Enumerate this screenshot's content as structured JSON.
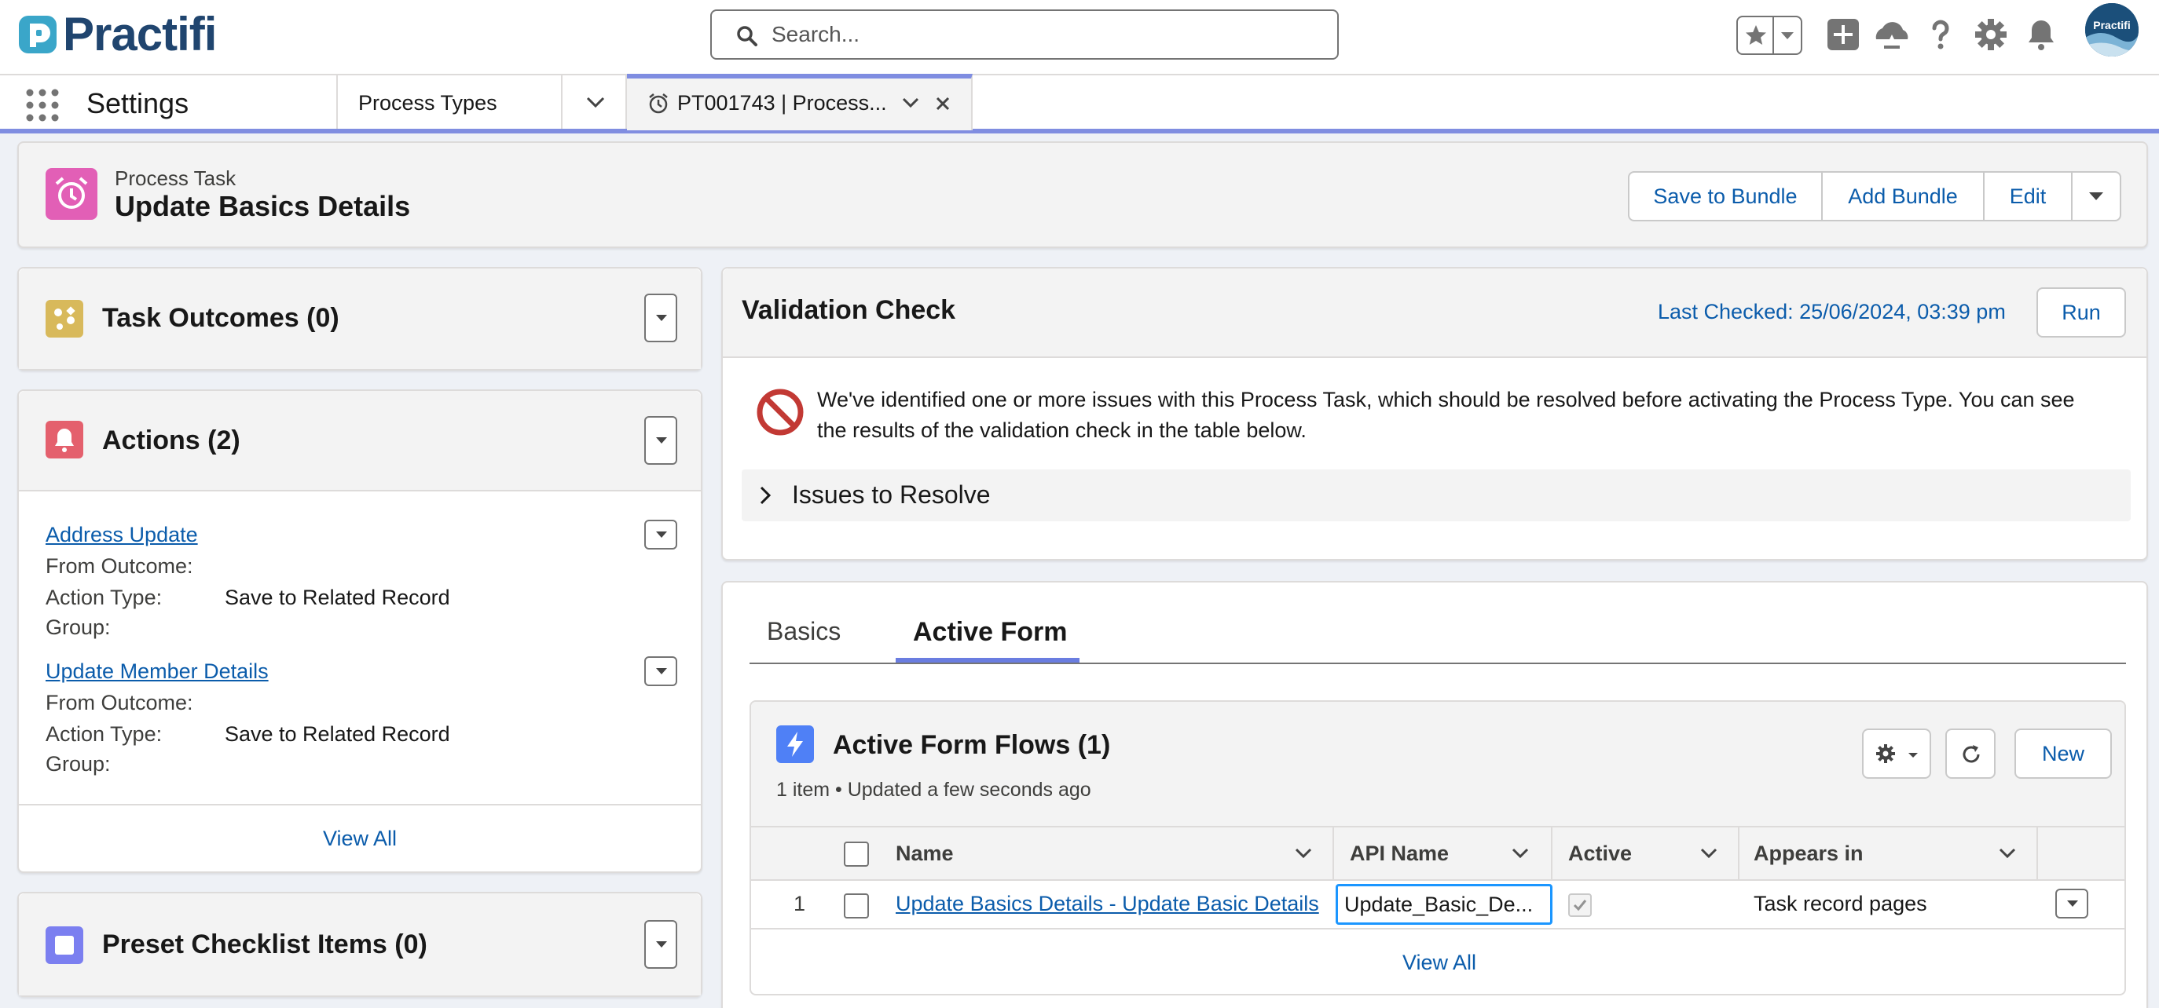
{
  "brand": {
    "name": "Practifi",
    "avatar_text": "Practifi"
  },
  "search": {
    "placeholder": "Search..."
  },
  "header_icons": [
    "star-icon",
    "add-icon",
    "trailhead-icon",
    "help-icon",
    "gear-icon",
    "bell-icon"
  ],
  "nav": {
    "app_name": "Settings",
    "tabs": [
      {
        "label": "Process Types"
      },
      {
        "label": "PT001743 | Process..."
      }
    ]
  },
  "record": {
    "type": "Process Task",
    "title": "Update Basics Details",
    "actions": [
      "Save to Bundle",
      "Add Bundle",
      "Edit"
    ]
  },
  "task_outcomes": {
    "title": "Task Outcomes (0)"
  },
  "actions_card": {
    "title": "Actions (2)",
    "items": [
      {
        "name": "Address Update",
        "from_outcome_label": "From Outcome:",
        "from_outcome": "",
        "action_type_label": "Action Type:",
        "action_type": "Save to Related Record",
        "group_label": "Group:",
        "group": ""
      },
      {
        "name": "Update Member Details",
        "from_outcome_label": "From Outcome:",
        "from_outcome": "",
        "action_type_label": "Action Type:",
        "action_type": "Save to Related Record",
        "group_label": "Group:",
        "group": ""
      }
    ],
    "view_all": "View All"
  },
  "checklist": {
    "title": "Preset Checklist Items (0)"
  },
  "validation": {
    "title": "Validation Check",
    "last_checked": "Last Checked: 25/06/2024, 03:39 pm",
    "run_label": "Run",
    "message": "We've identified one or more issues with this Process Task, which should be resolved before activating the Process Type. You can see the results of the validation check in the table below.",
    "issues_label": "Issues to Resolve"
  },
  "detail_tabs": {
    "basics": "Basics",
    "active_form": "Active Form"
  },
  "flows": {
    "title": "Active Form Flows (1)",
    "subtitle": "1 item • Updated a few seconds ago",
    "new_label": "New",
    "columns": [
      "Name",
      "API Name",
      "Active",
      "Appears in"
    ],
    "rows": [
      {
        "num": "1",
        "name": "Update Basics Details - Update Basic Details",
        "api_name": "Update_Basic_De...",
        "active": true,
        "appears_in": "Task record pages"
      }
    ],
    "view_all": "View All"
  },
  "colors": {
    "accent": "#0b5cab",
    "tab_accent": "#7f8de1",
    "task_icon": "#e25fb6",
    "outcome_icon": "#d8b95b",
    "action_icon": "#e4606d",
    "checklist_icon": "#7b7ff0",
    "flow_icon": "#4f80f6",
    "error": "#c23934"
  }
}
